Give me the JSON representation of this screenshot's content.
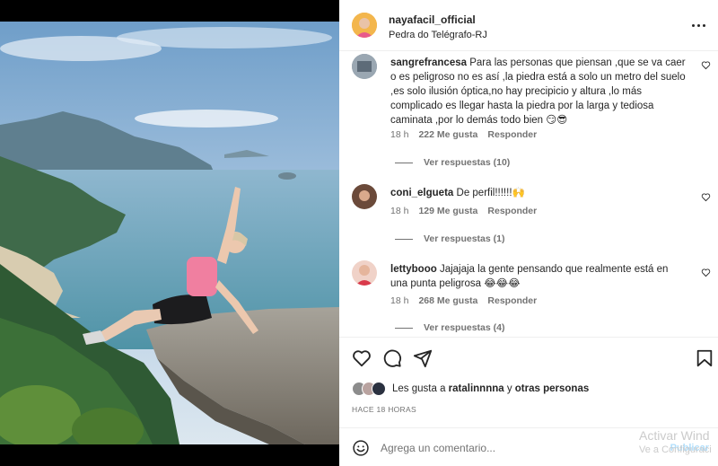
{
  "post": {
    "username": "nayafacil_official",
    "location": "Pedra do Telégrafo-RJ",
    "time_ago": "HACE 18 HORAS",
    "likes_prefix": "Les gusta a ",
    "likes_user": "ratalinnnna",
    "likes_middle": " y ",
    "likes_others": "otras personas"
  },
  "comments": [
    {
      "username": "sangrefrancesa",
      "text": "Para las personas que piensan ,que se va caer o es peligroso no es así ,la piedra está a solo un metro del suelo ,es solo ilusión óptica,no hay precipicio y altura ,lo más complicado es llegar hasta la piedra por la larga y tediosa caminata ,por lo demás todo bien 😏😎",
      "time": "18 h",
      "likes": "222 Me gusta",
      "reply_label": "Responder",
      "view_replies": "Ver respuestas (10)"
    },
    {
      "username": "coni_elgueta",
      "text": "De perfil!!!!!!🙌",
      "time": "18 h",
      "likes": "129 Me gusta",
      "reply_label": "Responder",
      "view_replies": "Ver respuestas (1)"
    },
    {
      "username": "lettybooo",
      "text": "Jajajaja la gente pensando que realmente está en una punta peligrosa 😂😂😂",
      "time": "18 h",
      "likes": "268 Me gusta",
      "reply_label": "Responder",
      "view_replies": "Ver respuestas (4)"
    }
  ],
  "composer": {
    "placeholder": "Agrega un comentario...",
    "publish_label": "Publicar"
  },
  "watermark": {
    "line1": "Activar Wind",
    "line2": "Ve a Configuraci"
  },
  "icons": {
    "more": "more-horizontal-icon",
    "like": "heart-icon",
    "comment": "comment-bubble-icon",
    "share": "paper-plane-icon",
    "save": "bookmark-icon",
    "emoji": "emoji-smile-icon"
  },
  "colors": {
    "text": "#262626",
    "muted": "#737373",
    "divider": "#efefef",
    "publish": "#b2dffc"
  }
}
